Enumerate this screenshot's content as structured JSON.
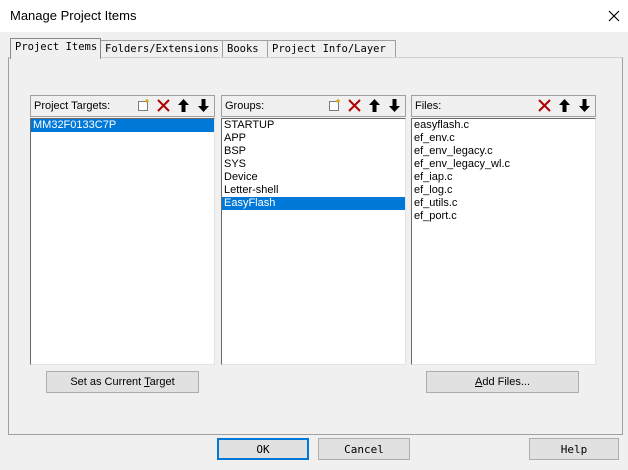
{
  "window": {
    "title": "Manage Project Items"
  },
  "tabs": [
    {
      "label": "Project Items",
      "active": true
    },
    {
      "label": "Folders/Extensions",
      "active": false
    },
    {
      "label": "Books",
      "active": false
    },
    {
      "label": "Project Info/Layer",
      "active": false
    }
  ],
  "targets": {
    "label": "Project Targets:",
    "items": [
      "MM32F0133C7P"
    ],
    "selected": 0,
    "button_pre": "Set as Current ",
    "button_key": "T",
    "button_post": "arget"
  },
  "groups": {
    "label": "Groups:",
    "items": [
      "STARTUP",
      "APP",
      "BSP",
      "SYS",
      "Device",
      "Letter-shell",
      "EasyFlash"
    ],
    "selected": 6
  },
  "files": {
    "label": "Files:",
    "items": [
      "easyflash.c",
      "ef_env.c",
      "ef_env_legacy.c",
      "ef_env_legacy_wl.c",
      "ef_iap.c",
      "ef_log.c",
      "ef_utils.c",
      "ef_port.c"
    ],
    "button_pre": "",
    "button_key": "A",
    "button_post": "dd Files..."
  },
  "footer": {
    "ok": "OK",
    "cancel": "Cancel",
    "help": "Help"
  },
  "icons": [
    "new-icon",
    "delete-icon",
    "move-up-icon",
    "move-down-icon",
    "close-icon"
  ]
}
